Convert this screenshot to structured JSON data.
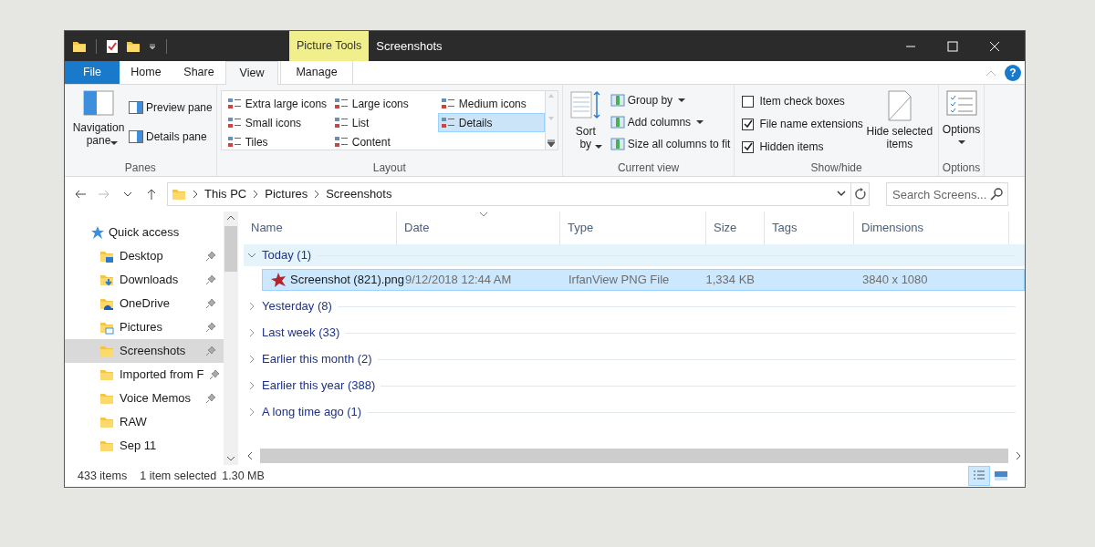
{
  "window": {
    "title": "Screenshots",
    "context_label": "Picture Tools"
  },
  "ribbon": {
    "tabs": [
      {
        "label": "File",
        "kind": "file",
        "selected": false
      },
      {
        "label": "Home",
        "kind": "tab",
        "selected": false
      },
      {
        "label": "Share",
        "kind": "tab",
        "selected": false
      },
      {
        "label": "View",
        "kind": "tab",
        "selected": true
      },
      {
        "label": "Manage",
        "kind": "context",
        "selected": false
      }
    ],
    "panes": {
      "label": "Panes",
      "navigation_pane": "Navigation pane",
      "preview_pane": "Preview pane",
      "details_pane": "Details pane"
    },
    "layout": {
      "label": "Layout",
      "options": [
        {
          "label": "Extra large icons",
          "selected": false
        },
        {
          "label": "Large icons",
          "selected": false
        },
        {
          "label": "Medium icons",
          "selected": false
        },
        {
          "label": "Small icons",
          "selected": false
        },
        {
          "label": "List",
          "selected": false
        },
        {
          "label": "Details",
          "selected": true
        },
        {
          "label": "Tiles",
          "selected": false
        },
        {
          "label": "Content",
          "selected": false
        }
      ]
    },
    "current_view": {
      "label": "Current view",
      "sort_by": "Sort by",
      "group_by": "Group by",
      "add_columns": "Add columns",
      "size_columns": "Size all columns to fit"
    },
    "show_hide": {
      "label": "Show/hide",
      "checkboxes": [
        {
          "label": "Item check boxes",
          "checked": false
        },
        {
          "label": "File name extensions",
          "checked": true
        },
        {
          "label": "Hidden items",
          "checked": true
        }
      ],
      "hide_selected": "Hide selected items"
    },
    "options": {
      "label": "Options",
      "button_label": "Options"
    },
    "help": "?"
  },
  "address": {
    "crumbs": [
      "This PC",
      "Pictures",
      "Screenshots"
    ],
    "search_placeholder": "Search Screens..."
  },
  "navigation": [
    {
      "label": "Quick access",
      "kind": "quick",
      "pinned": false,
      "selected": false
    },
    {
      "label": "Desktop",
      "kind": "desktop",
      "pinned": true,
      "selected": false
    },
    {
      "label": "Downloads",
      "kind": "downloads",
      "pinned": true,
      "selected": false
    },
    {
      "label": "OneDrive",
      "kind": "onedrive",
      "pinned": true,
      "selected": false
    },
    {
      "label": "Pictures",
      "kind": "pictures",
      "pinned": true,
      "selected": false
    },
    {
      "label": "Screenshots",
      "kind": "folder",
      "pinned": true,
      "selected": true
    },
    {
      "label": "Imported from F",
      "kind": "folder",
      "pinned": true,
      "selected": false
    },
    {
      "label": "Voice Memos",
      "kind": "folder",
      "pinned": true,
      "selected": false
    },
    {
      "label": "RAW",
      "kind": "folder",
      "pinned": false,
      "selected": false
    },
    {
      "label": "Sep 11",
      "kind": "folder",
      "pinned": false,
      "selected": false
    }
  ],
  "table": {
    "columns": [
      "Name",
      "Date",
      "Type",
      "Size",
      "Tags",
      "Dimensions"
    ],
    "groups": [
      {
        "label": "Today (1)",
        "expanded": true,
        "rows": [
          {
            "name": "Screenshot (821).png",
            "date": "9/12/2018 12:44 AM",
            "type": "IrfanView PNG File",
            "size": "1,334 KB",
            "dimensions": "3840 x 1080",
            "selected": true
          }
        ]
      },
      {
        "label": "Yesterday (8)",
        "expanded": false
      },
      {
        "label": "Last week (33)",
        "expanded": false
      },
      {
        "label": "Earlier this month (2)",
        "expanded": false
      },
      {
        "label": "Earlier this year (388)",
        "expanded": false
      },
      {
        "label": "A long time ago (1)",
        "expanded": false
      }
    ]
  },
  "status_bar": {
    "item_count": "433 items",
    "selection": "1 item selected",
    "selection_size": "1.30 MB",
    "views": [
      {
        "kind": "details",
        "selected": true
      },
      {
        "kind": "thumbnails",
        "selected": false
      }
    ]
  }
}
